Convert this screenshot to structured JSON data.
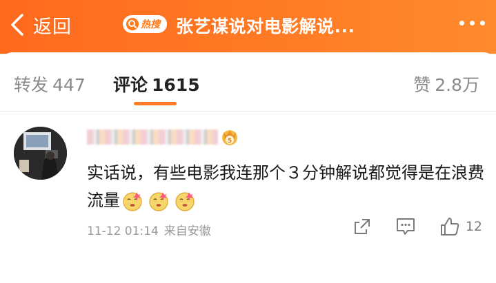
{
  "colors": {
    "accent": "#ff7a24",
    "header": "#ff6a1e",
    "muted": "#8a8a8a"
  },
  "header": {
    "back_label": "返回",
    "hot_badge_label": "热搜",
    "title": "张艺谋说对电影解说..."
  },
  "tabs": {
    "repost": {
      "label": "转发",
      "count": "447"
    },
    "comment": {
      "label": "评论",
      "count": "1615"
    },
    "like": {
      "label": "赞",
      "count": "2.8万"
    }
  },
  "comment": {
    "text": "实话说，有些电影我连那个３分钟解说都觉得是在浪费流量",
    "emoji_name": "doge-dizzy-icon",
    "date": "11-12 01:14",
    "source": "来自安徽",
    "like_count": "12"
  }
}
